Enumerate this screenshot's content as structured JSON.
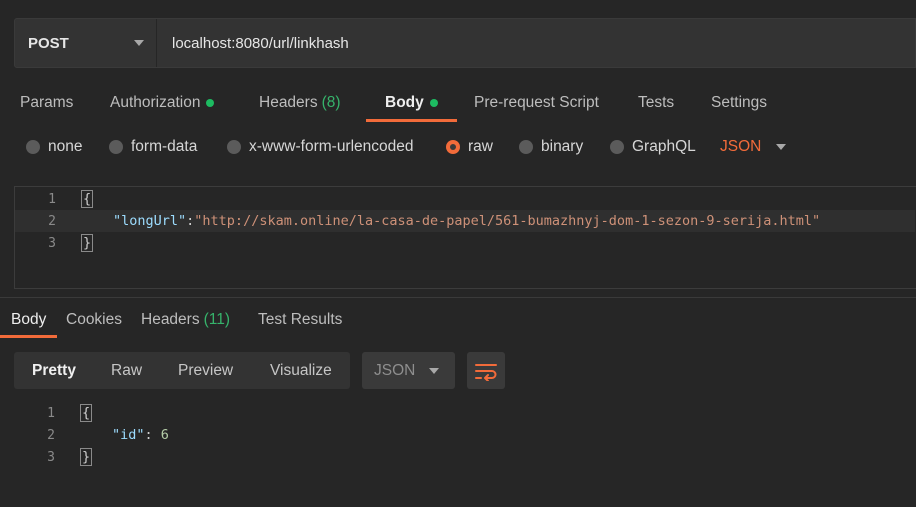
{
  "request": {
    "method": "POST",
    "url": "localhost:8080/url/linkhash"
  },
  "request_tabs": [
    {
      "label": "Params"
    },
    {
      "label": "Authorization"
    },
    {
      "label": "Headers",
      "count": "(8)"
    },
    {
      "label": "Body"
    },
    {
      "label": "Pre-request Script"
    },
    {
      "label": "Tests"
    },
    {
      "label": "Settings"
    }
  ],
  "body_types": {
    "none": "none",
    "form_data": "form-data",
    "urlencoded": "x-www-form-urlencoded",
    "raw": "raw",
    "binary": "binary",
    "graphql": "GraphQL",
    "language": "JSON"
  },
  "request_body": {
    "line_numbers": [
      "1",
      "2",
      "3"
    ],
    "open_brace": "{",
    "key": "\"longUrl\"",
    "colon": ":",
    "value": "\"http://skam.online/la-casa-de-papel/561-bumazhnyj-dom-1-sezon-9-serija.html\"",
    "close_brace": "}"
  },
  "response_tabs": [
    {
      "label": "Body"
    },
    {
      "label": "Cookies"
    },
    {
      "label": "Headers",
      "count": "(11)"
    },
    {
      "label": "Test Results"
    }
  ],
  "response_view": {
    "pretty": "Pretty",
    "raw": "Raw",
    "preview": "Preview",
    "visualize": "Visualize",
    "format": "JSON"
  },
  "response_body": {
    "line_numbers": [
      "1",
      "2",
      "3"
    ],
    "open_brace": "{",
    "key": "\"id\"",
    "colon": ": ",
    "value": "6",
    "close_brace": "}"
  },
  "colors": {
    "accent": "#f26b3a",
    "status_green": "#1dbb61",
    "background": "#262626"
  }
}
